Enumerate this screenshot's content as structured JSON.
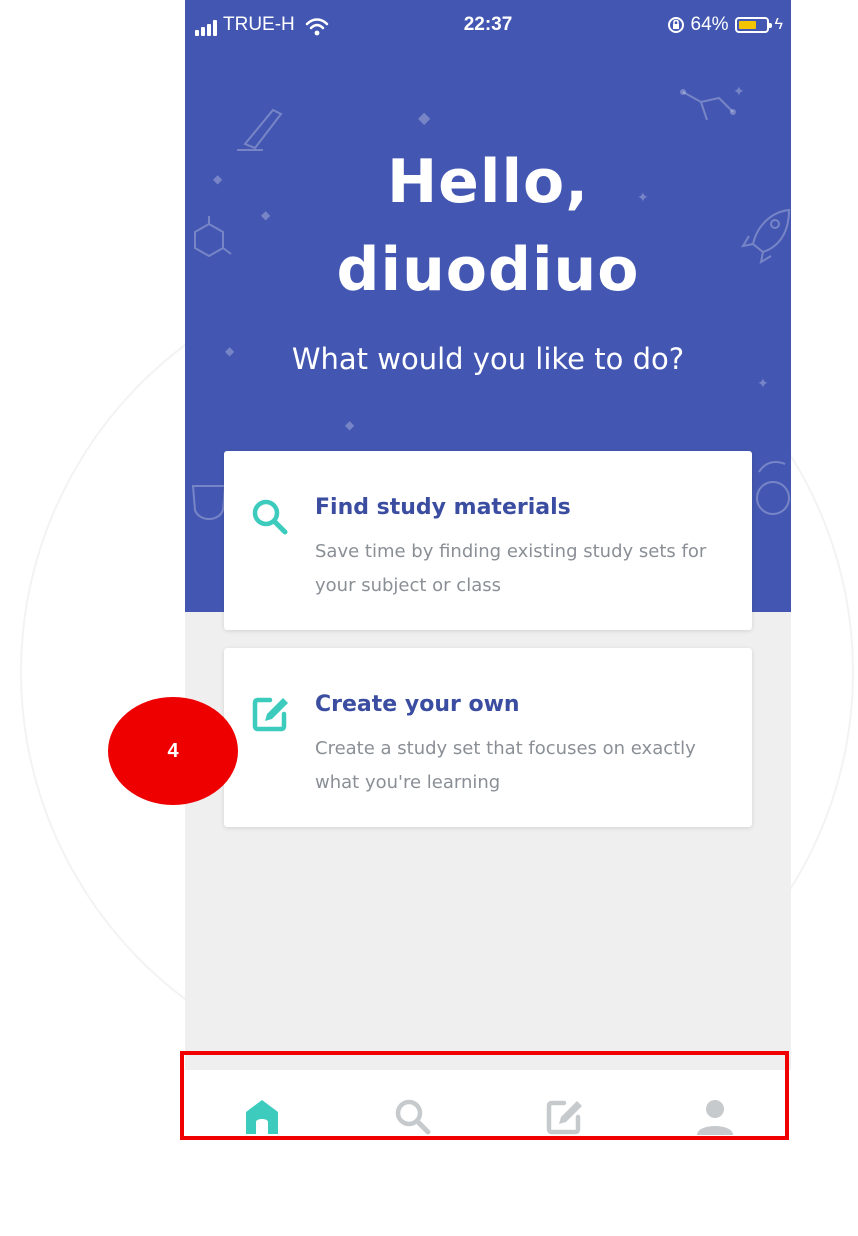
{
  "status_bar": {
    "carrier": "TRUE-H",
    "time": "22:37",
    "battery_percent": "64%",
    "battery_level": 0.64,
    "battery_color": "#f5c400"
  },
  "hero": {
    "greeting_line1": "Hello,",
    "greeting_line2": "diuodiuo",
    "question": "What would you like to do?",
    "background_color": "#4357b2"
  },
  "cards": [
    {
      "title": "Find study materials",
      "description": "Save time by finding existing study sets for your subject or class",
      "icon": "search-icon"
    },
    {
      "title": "Create your own",
      "description": "Create a study set that focuses on exactly what you're learning",
      "icon": "edit-icon"
    }
  ],
  "tab_bar": {
    "tabs": [
      {
        "icon": "home-icon",
        "active": true
      },
      {
        "icon": "search-icon",
        "active": false
      },
      {
        "icon": "edit-icon",
        "active": false
      },
      {
        "icon": "profile-icon",
        "active": false
      }
    ],
    "active_color": "#3ccbbd",
    "inactive_color": "#c7cacd"
  },
  "annotation": {
    "step_number": "4",
    "highlight_color": "#f00000"
  }
}
